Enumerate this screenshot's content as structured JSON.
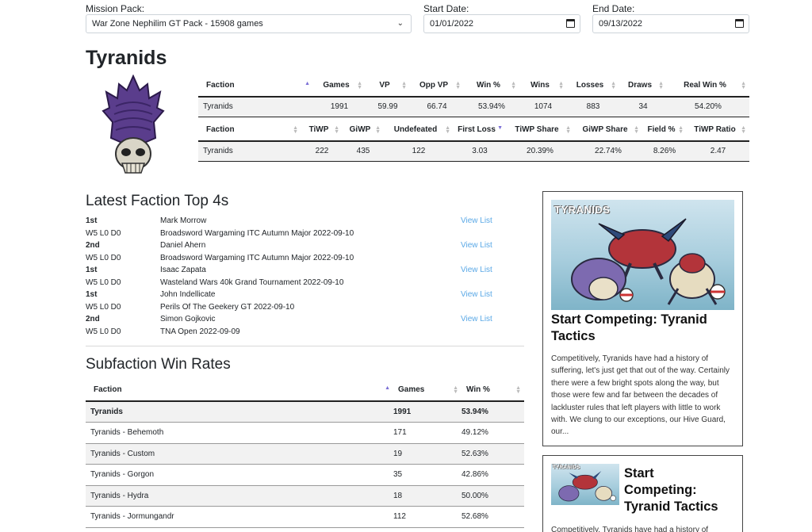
{
  "filters": {
    "mission_pack_label": "Mission Pack:",
    "mission_pack_value": "War Zone Nephilim GT Pack - 15908 games",
    "start_label": "Start Date:",
    "start_value": "01/01/2022",
    "end_label": "End Date:",
    "end_value": "09/13/2022"
  },
  "title": "Tyranids",
  "stats1": {
    "headers": [
      "Faction",
      "Games",
      "VP",
      "Opp VP",
      "Win %",
      "Wins",
      "Losses",
      "Draws",
      "Real Win %"
    ],
    "row": [
      "Tyranids",
      "1991",
      "59.99",
      "66.74",
      "53.94%",
      "1074",
      "883",
      "34",
      "54.20%"
    ]
  },
  "stats2": {
    "headers": [
      "Faction",
      "TiWP",
      "GiWP",
      "Undefeated",
      "First Loss",
      "TiWP Share",
      "GiWP Share",
      "Field %",
      "TiWP Ratio"
    ],
    "row": [
      "Tyranids",
      "222",
      "435",
      "122",
      "3.03",
      "20.39%",
      "22.74%",
      "8.26%",
      "2.47"
    ]
  },
  "top4": {
    "title": "Latest Faction Top 4s",
    "link_label": "View List",
    "entries": [
      {
        "place": "1st",
        "player": "Mark Morrow",
        "record": "W5 L0 D0",
        "event": "Broadsword Wargaming ITC Autumn Major 2022-09-10"
      },
      {
        "place": "2nd",
        "player": "Daniel Ahern",
        "record": "W5 L0 D0",
        "event": "Broadsword Wargaming ITC Autumn Major 2022-09-10"
      },
      {
        "place": "1st",
        "player": "Isaac Zapata",
        "record": "W5 L0 D0",
        "event": "Wasteland Wars 40k Grand Tournament 2022-09-10"
      },
      {
        "place": "1st",
        "player": "John Indellicate",
        "record": "W5 L0 D0",
        "event": "Perils Of The Geekery GT 2022-09-10"
      },
      {
        "place": "2nd",
        "player": "Simon Gojkovic",
        "record": "W5 L0 D0",
        "event": "TNA Open 2022-09-09"
      }
    ]
  },
  "subfaction": {
    "title": "Subfaction Win Rates",
    "headers": [
      "Faction",
      "Games",
      "Win %"
    ],
    "rows": [
      [
        "Tyranids",
        "1991",
        "53.94%"
      ],
      [
        "Tyranids - Behemoth",
        "171",
        "49.12%"
      ],
      [
        "Tyranids - Custom",
        "19",
        "52.63%"
      ],
      [
        "Tyranids - Gorgon",
        "35",
        "42.86%"
      ],
      [
        "Tyranids - Hydra",
        "18",
        "50.00%"
      ],
      [
        "Tyranids - Jormungandr",
        "112",
        "52.68%"
      ]
    ]
  },
  "card1": {
    "art_tag": "TYRANIDS",
    "title": "Start Competing: Tyranid Tactics",
    "excerpt": "Competitively, Tyranids have had a history of suffering, let's just get that out of the way. Certainly there were a few bright spots along the way, but those were few and far between the decades of lackluster rules that left players with little to work with. We clung to our exceptions, our Hive Guard, our..."
  },
  "card2": {
    "art_tag": "TYRANIDS",
    "title": "Start Competing: Tyranid Tactics",
    "excerpt": "Competitively, Tyranids have had a history of"
  },
  "colors": {
    "accent_link": "#5aa8e6",
    "sort_active": "#7b6fd6",
    "row_shade": "#f2f2f2"
  }
}
